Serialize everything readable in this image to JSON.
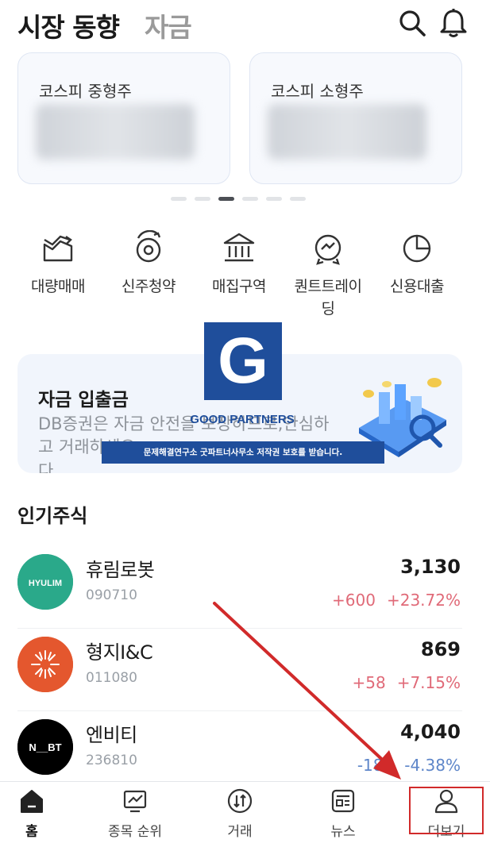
{
  "header": {
    "title": "시장 동향",
    "subtitle": "자금"
  },
  "market_cards": [
    {
      "title": "코스피 중형주"
    },
    {
      "title": "코스피 소형주"
    }
  ],
  "carousel": {
    "total": 6,
    "active": 3
  },
  "quick_menu": [
    {
      "icon": "chart-area-icon",
      "label": "대량매매"
    },
    {
      "icon": "subscription-icon",
      "label": "신주청약"
    },
    {
      "icon": "bank-icon",
      "label": "매집구역"
    },
    {
      "icon": "quant-trading-icon",
      "label": "퀀트트레이\n딩"
    },
    {
      "icon": "pie-chart-icon",
      "label": "신용대출"
    }
  ],
  "promo": {
    "title": "자금 입출금",
    "description": "DB증권은 자금 안전을 보장하므로,안심하고 거래하세요.\n다."
  },
  "watermark": {
    "letter": "G",
    "name": "GOOD PARTNERS",
    "notice": "문제해결연구소 굿파트너사무소 저작권 보호를 받습니다."
  },
  "popular": {
    "title": "인기주식",
    "stocks": [
      {
        "name": "휴림로봇",
        "code": "090710",
        "price": "3,130",
        "change": "+600",
        "pct": "+23.72%",
        "dir": "up",
        "logo_text": "HYULIM",
        "logo_color": "#2aa98a"
      },
      {
        "name": "형지I&C",
        "code": "011080",
        "price": "869",
        "change": "+58",
        "pct": "+7.15%",
        "dir": "up",
        "logo_text": "",
        "logo_color": "#e4572e"
      },
      {
        "name": "엔비티",
        "code": "236810",
        "price": "4,040",
        "change": "-180",
        "pct": "-4.38%",
        "dir": "down",
        "logo_text": "N__BT",
        "logo_color": "#000000"
      }
    ]
  },
  "tabbar": {
    "tabs": [
      {
        "label": "홈",
        "icon": "home-icon",
        "active": true
      },
      {
        "label": "종목 순위",
        "icon": "ranking-chart-icon",
        "active": false
      },
      {
        "label": "거래",
        "icon": "trade-icon",
        "active": false
      },
      {
        "label": "뉴스",
        "icon": "news-icon",
        "active": false
      },
      {
        "label": "더보기",
        "icon": "person-icon",
        "active": false
      }
    ]
  },
  "colors": {
    "up": "#e06a78",
    "down": "#5e86c9",
    "annotation": "#d12a2a",
    "watermark": "#1f4e9b"
  }
}
